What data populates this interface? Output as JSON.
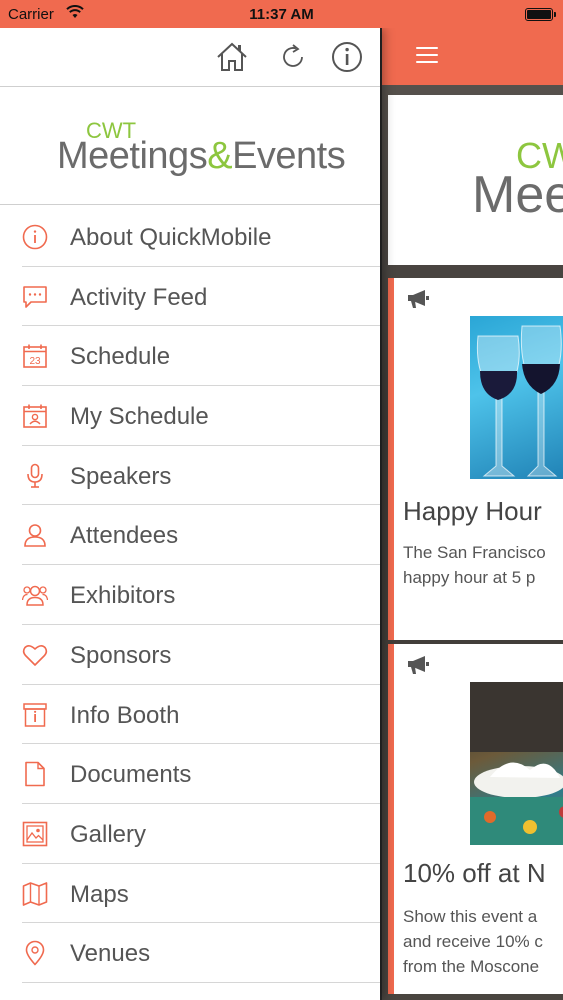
{
  "status_bar": {
    "carrier": "Carrier",
    "time": "11:37 AM"
  },
  "accent_color": "#f06a4f",
  "logo_green": "#8dc63f",
  "drawer": {
    "toolbar": [
      {
        "name": "home-icon"
      },
      {
        "name": "refresh-icon"
      },
      {
        "name": "info-icon"
      }
    ],
    "logo": {
      "brand_top": "CWT",
      "brand_main": "Meetings",
      "brand_amp": "&",
      "brand_end": "Events"
    },
    "menu": [
      {
        "label": "About QuickMobile",
        "icon": "info-circle-icon"
      },
      {
        "label": "Activity Feed",
        "icon": "chat-bubble-icon"
      },
      {
        "label": "Schedule",
        "icon": "calendar-icon",
        "icon_text": "23"
      },
      {
        "label": "My Schedule",
        "icon": "calendar-person-icon"
      },
      {
        "label": "Speakers",
        "icon": "microphone-icon"
      },
      {
        "label": "Attendees",
        "icon": "person-icon"
      },
      {
        "label": "Exhibitors",
        "icon": "group-icon"
      },
      {
        "label": "Sponsors",
        "icon": "heart-icon"
      },
      {
        "label": "Info Booth",
        "icon": "info-booth-icon"
      },
      {
        "label": "Documents",
        "icon": "document-icon"
      },
      {
        "label": "Gallery",
        "icon": "gallery-icon"
      },
      {
        "label": "Maps",
        "icon": "map-icon"
      },
      {
        "label": "Venues",
        "icon": "location-pin-icon"
      }
    ]
  },
  "main": {
    "banner": {
      "brand_top": "CW",
      "brand_main": "Mee"
    },
    "cards": [
      {
        "title": "Happy Hour",
        "text_line1": "The San Francisco",
        "text_line2": "happy hour at 5 p"
      },
      {
        "title": "10% off at N",
        "text_line1": "Show this event a",
        "text_line2": "and receive 10% c",
        "text_line3": "from the Moscone"
      }
    ]
  }
}
